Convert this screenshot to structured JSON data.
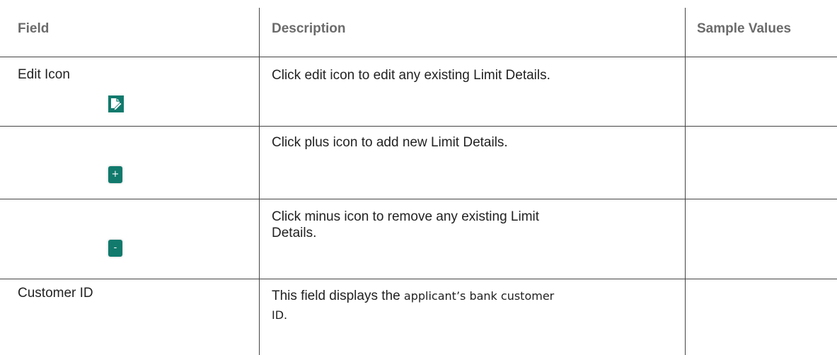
{
  "table": {
    "headers": {
      "field": "Field",
      "description": "Description",
      "sample_values": "Sample Values"
    },
    "rows": [
      {
        "field": "Edit Icon",
        "icon": "edit-icon",
        "description": "Click edit icon to edit any existing Limit Details.",
        "sample": ""
      },
      {
        "field": "",
        "icon": "plus-icon",
        "icon_glyph": "+",
        "description": "Click plus icon to add new Limit Details.",
        "sample": ""
      },
      {
        "field": "",
        "icon": "minus-icon",
        "icon_glyph": "-",
        "description_line1": "Click minus icon to remove any existing Limit",
        "description_line2": "Details.",
        "sample": ""
      },
      {
        "field": "Customer ID",
        "description_part1": "This field displays the ",
        "description_part2": "applicant’s bank customer",
        "description_line2": "ID.",
        "sample": ""
      }
    ]
  },
  "colors": {
    "accent": "#117a6d",
    "header_text": "#6b6b6b",
    "border": "#444444"
  }
}
